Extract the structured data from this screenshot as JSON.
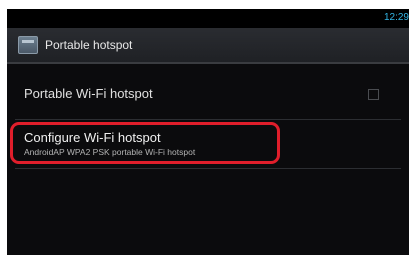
{
  "status_bar": {
    "time": "12:29"
  },
  "action_bar": {
    "icon": "settings-app-icon",
    "title": "Portable hotspot"
  },
  "settings": {
    "portable_hotspot": {
      "label": "Portable Wi-Fi hotspot",
      "checked": false
    },
    "configure_hotspot": {
      "label": "Configure Wi-Fi hotspot",
      "summary": "AndroidAP WPA2 PSK portable Wi-Fi hotspot"
    }
  },
  "colors": {
    "clock": "#33b5e5",
    "highlight": "#e01e2b",
    "background": "#0b0b0d"
  }
}
